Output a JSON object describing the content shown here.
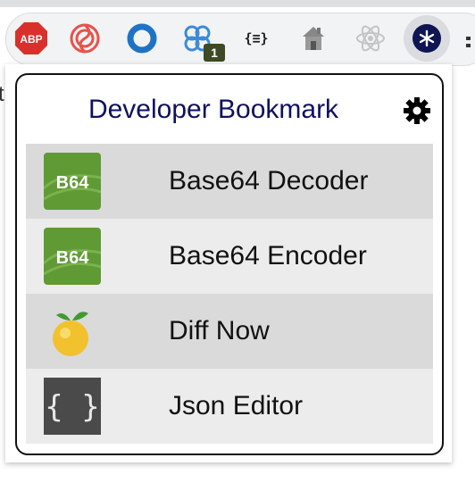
{
  "toolbar": {
    "extensions": [
      {
        "icon": "adblock-plus-icon",
        "text": "ABP"
      },
      {
        "icon": "swirl-logo-icon"
      },
      {
        "icon": "ring-logo-icon"
      },
      {
        "icon": "clover-icon",
        "badge": "1"
      },
      {
        "icon": "json-brackets-icon",
        "text": "{≡}"
      },
      {
        "icon": "house-icon"
      },
      {
        "icon": "react-atom-icon"
      },
      {
        "icon": "asterisk-icon"
      }
    ]
  },
  "popup": {
    "title": "Developer Bookmark",
    "settings_icon": "gear-icon",
    "items": [
      {
        "label": "Base64 Decoder",
        "icon_text": "B64",
        "icon": "base64-icon"
      },
      {
        "label": "Base64 Encoder",
        "icon_text": "B64",
        "icon": "base64-icon"
      },
      {
        "label": "Diff Now",
        "icon": "citrus-fruit-icon"
      },
      {
        "label": "Json Editor",
        "icon_text": "{ }",
        "icon": "curly-braces-icon"
      }
    ]
  },
  "colors": {
    "title": "#101060",
    "row_dark": "#dadada",
    "row_light": "#ececec",
    "b64_green": "#5f9a34",
    "badge": "#3d4a24"
  }
}
